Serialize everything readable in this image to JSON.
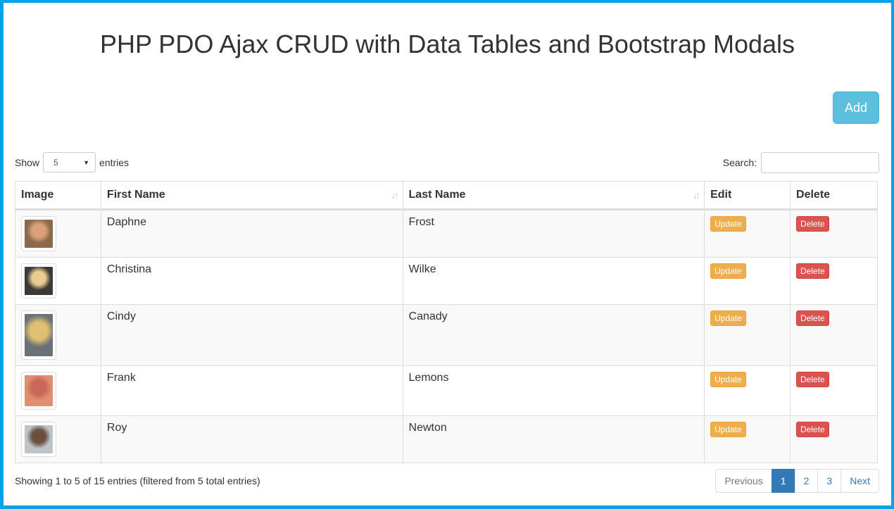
{
  "page": {
    "title": "PHP PDO Ajax CRUD with Data Tables and Bootstrap Modals",
    "add_label": "Add",
    "frame_color": "#00a2e8"
  },
  "controls": {
    "show_label": "Show",
    "entries_label": "entries",
    "length_value": "5",
    "search_label": "Search:",
    "search_value": ""
  },
  "table": {
    "headers": [
      "Image",
      "First Name",
      "Last Name",
      "Edit",
      "Delete"
    ],
    "rows": [
      {
        "first": "Daphne",
        "last": "Frost",
        "update": "Update",
        "delete": "Delete",
        "avatar_colors": [
          "#8a6a4a",
          "#d9a07a"
        ]
      },
      {
        "first": "Christina",
        "last": "Wilke",
        "update": "Update",
        "delete": "Delete",
        "avatar_colors": [
          "#3c3a38",
          "#e8cc90"
        ]
      },
      {
        "first": "Cindy",
        "last": "Canady",
        "update": "Update",
        "delete": "Delete",
        "avatar_colors": [
          "#6c7078",
          "#e0c070"
        ]
      },
      {
        "first": "Frank",
        "last": "Lemons",
        "update": "Update",
        "delete": "Delete",
        "avatar_colors": [
          "#e09070",
          "#c86858"
        ]
      },
      {
        "first": "Roy",
        "last": "Newton",
        "update": "Update",
        "delete": "Delete",
        "avatar_colors": [
          "#bcc4cc",
          "#6a5040"
        ]
      }
    ]
  },
  "footer": {
    "info": "Showing 1 to 5 of 15 entries (filtered from 5 total entries)",
    "pagination": [
      "Previous",
      "1",
      "2",
      "3",
      "Next"
    ],
    "active_page": "1"
  },
  "colors": {
    "add": "#5bc0de",
    "update": "#f0ad4e",
    "delete": "#d9534f",
    "active_page": "#337ab7"
  }
}
